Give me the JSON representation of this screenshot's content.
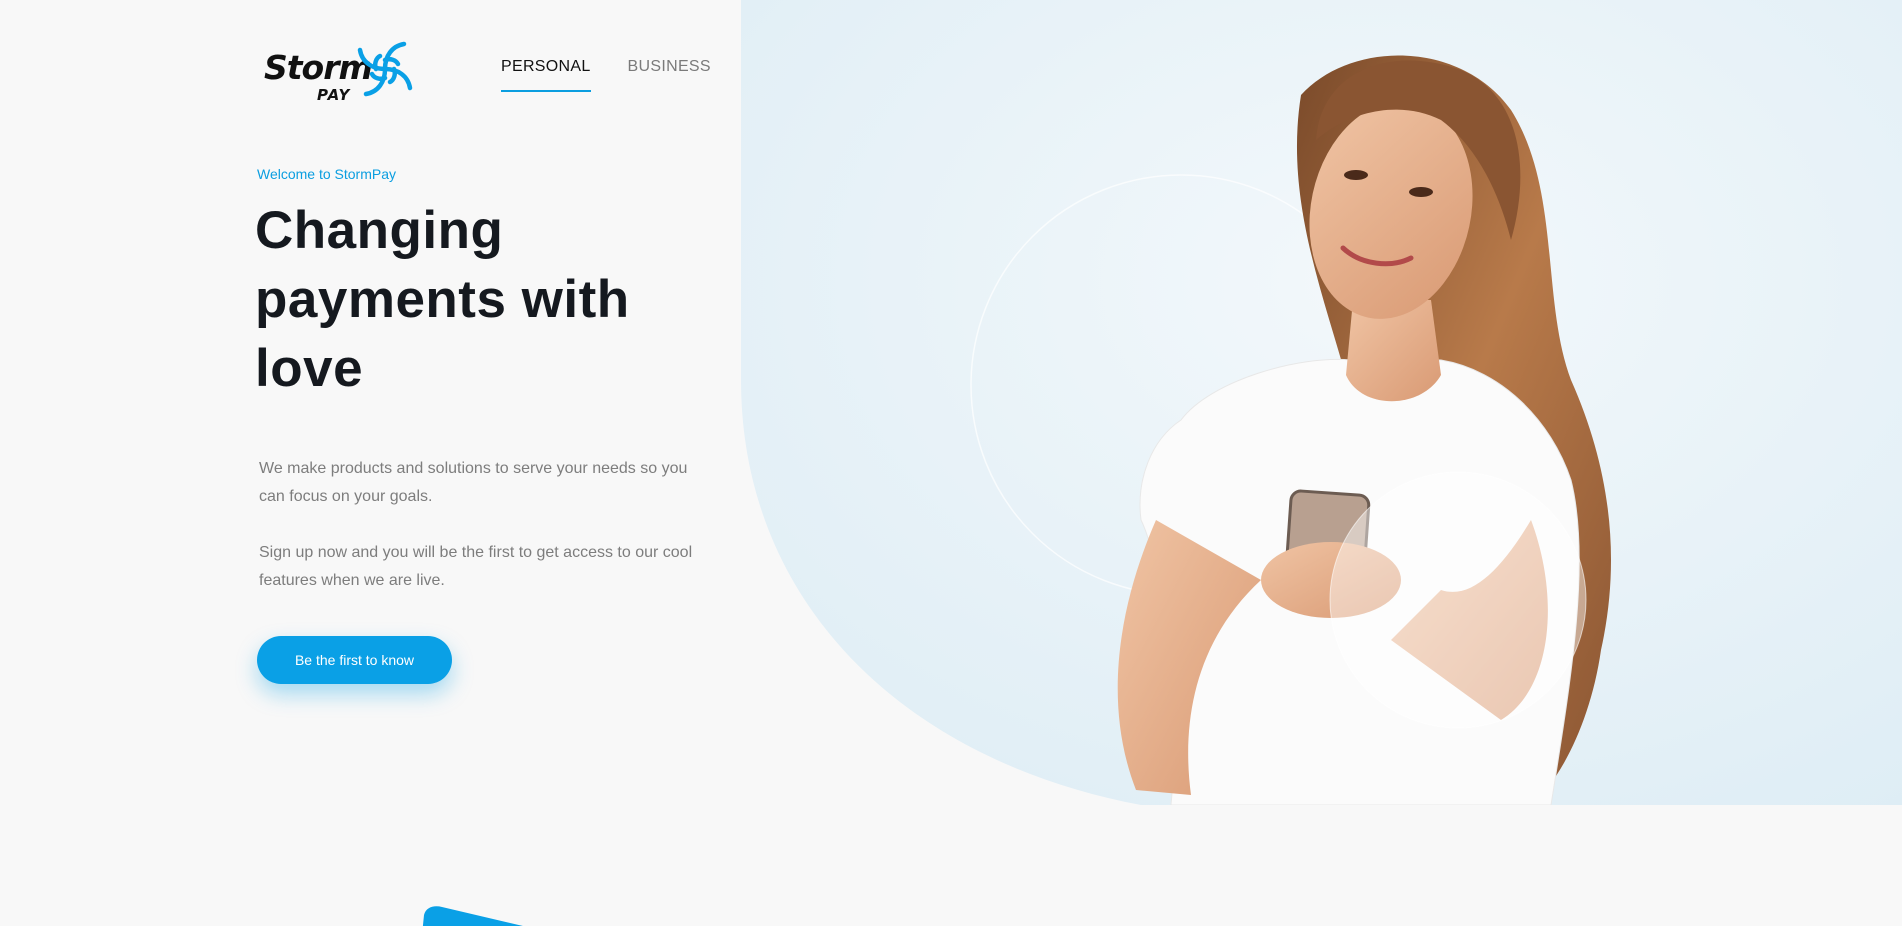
{
  "brand": {
    "logo_text": "Storm",
    "logo_sub": "PAY",
    "accent_color": "#0aa0e6"
  },
  "nav": {
    "items": [
      {
        "label": "PERSONAL",
        "active": true
      },
      {
        "label": "BUSINESS",
        "active": false
      }
    ]
  },
  "hero": {
    "eyebrow": "Welcome to StormPay",
    "headline_line1": "Changing",
    "headline_line2": "payments with",
    "headline_line3": "love",
    "paragraph1": "We make products and solutions to serve your needs so you can focus on your goals.",
    "paragraph2": "Sign up now and you will be the first to get access to our cool features when we are live.",
    "cta_label": "Be the first to know",
    "image_alt": "woman-holding-phone-photo"
  }
}
